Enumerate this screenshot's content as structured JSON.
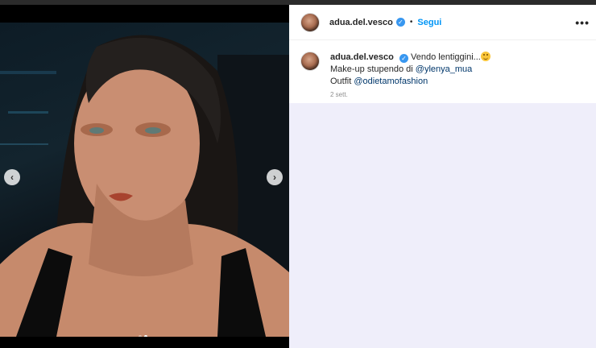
{
  "post": {
    "username": "adua.del.vesco",
    "follow_label": "Segui",
    "separator": "•",
    "more_label": "•••",
    "verified_icon": "verified-badge-icon",
    "caption": {
      "username": "adua.del.vesco",
      "line1": "Vendo lentiggini...",
      "line2_prefix": "Make-up stupendo di ",
      "line2_mention": "@ylenya_mua",
      "line3_prefix": "Outfit ",
      "line3_mention": "@odietamofashion"
    },
    "timestamp": "2 sett."
  },
  "carousel": {
    "prev_label": "‹",
    "next_label": "›",
    "slide_count": 2,
    "active_slide": 2
  },
  "colors": {
    "follow": "#0095f6",
    "mention": "#00376b",
    "panel_bg": "#efeefa"
  }
}
